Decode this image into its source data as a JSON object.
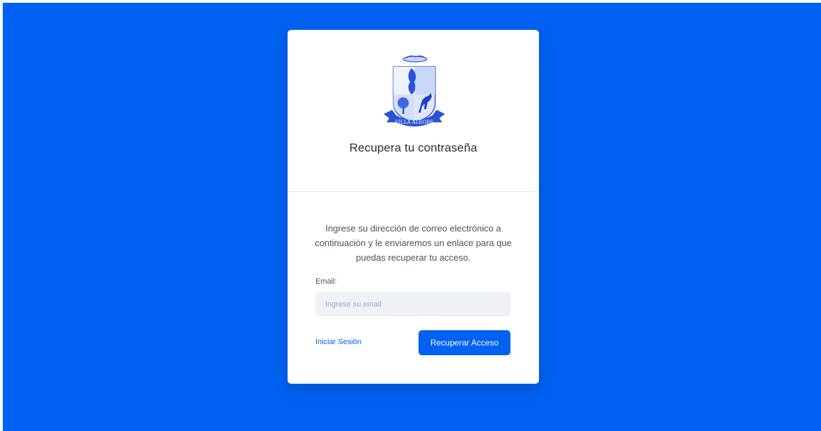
{
  "logo": {
    "icon": "villa-alegre-coat-of-arms-icon",
    "text": "VILLA ALEGRE"
  },
  "title": "Recupera tu contraseña",
  "description": "Ingrese su dirección de correo electrónico a continuación y le enviaremos un enlace para que puedas recuperar tu acceso.",
  "form": {
    "email_label": "Email:",
    "email_placeholder": "Ingrese su email",
    "email_value": ""
  },
  "actions": {
    "login_link": "Iniciar Sesión",
    "recover_button": "Recuperar Acceso"
  },
  "colors": {
    "background": "#0061f2",
    "primary": "#0061f2",
    "input_bg": "#eef1f7"
  }
}
